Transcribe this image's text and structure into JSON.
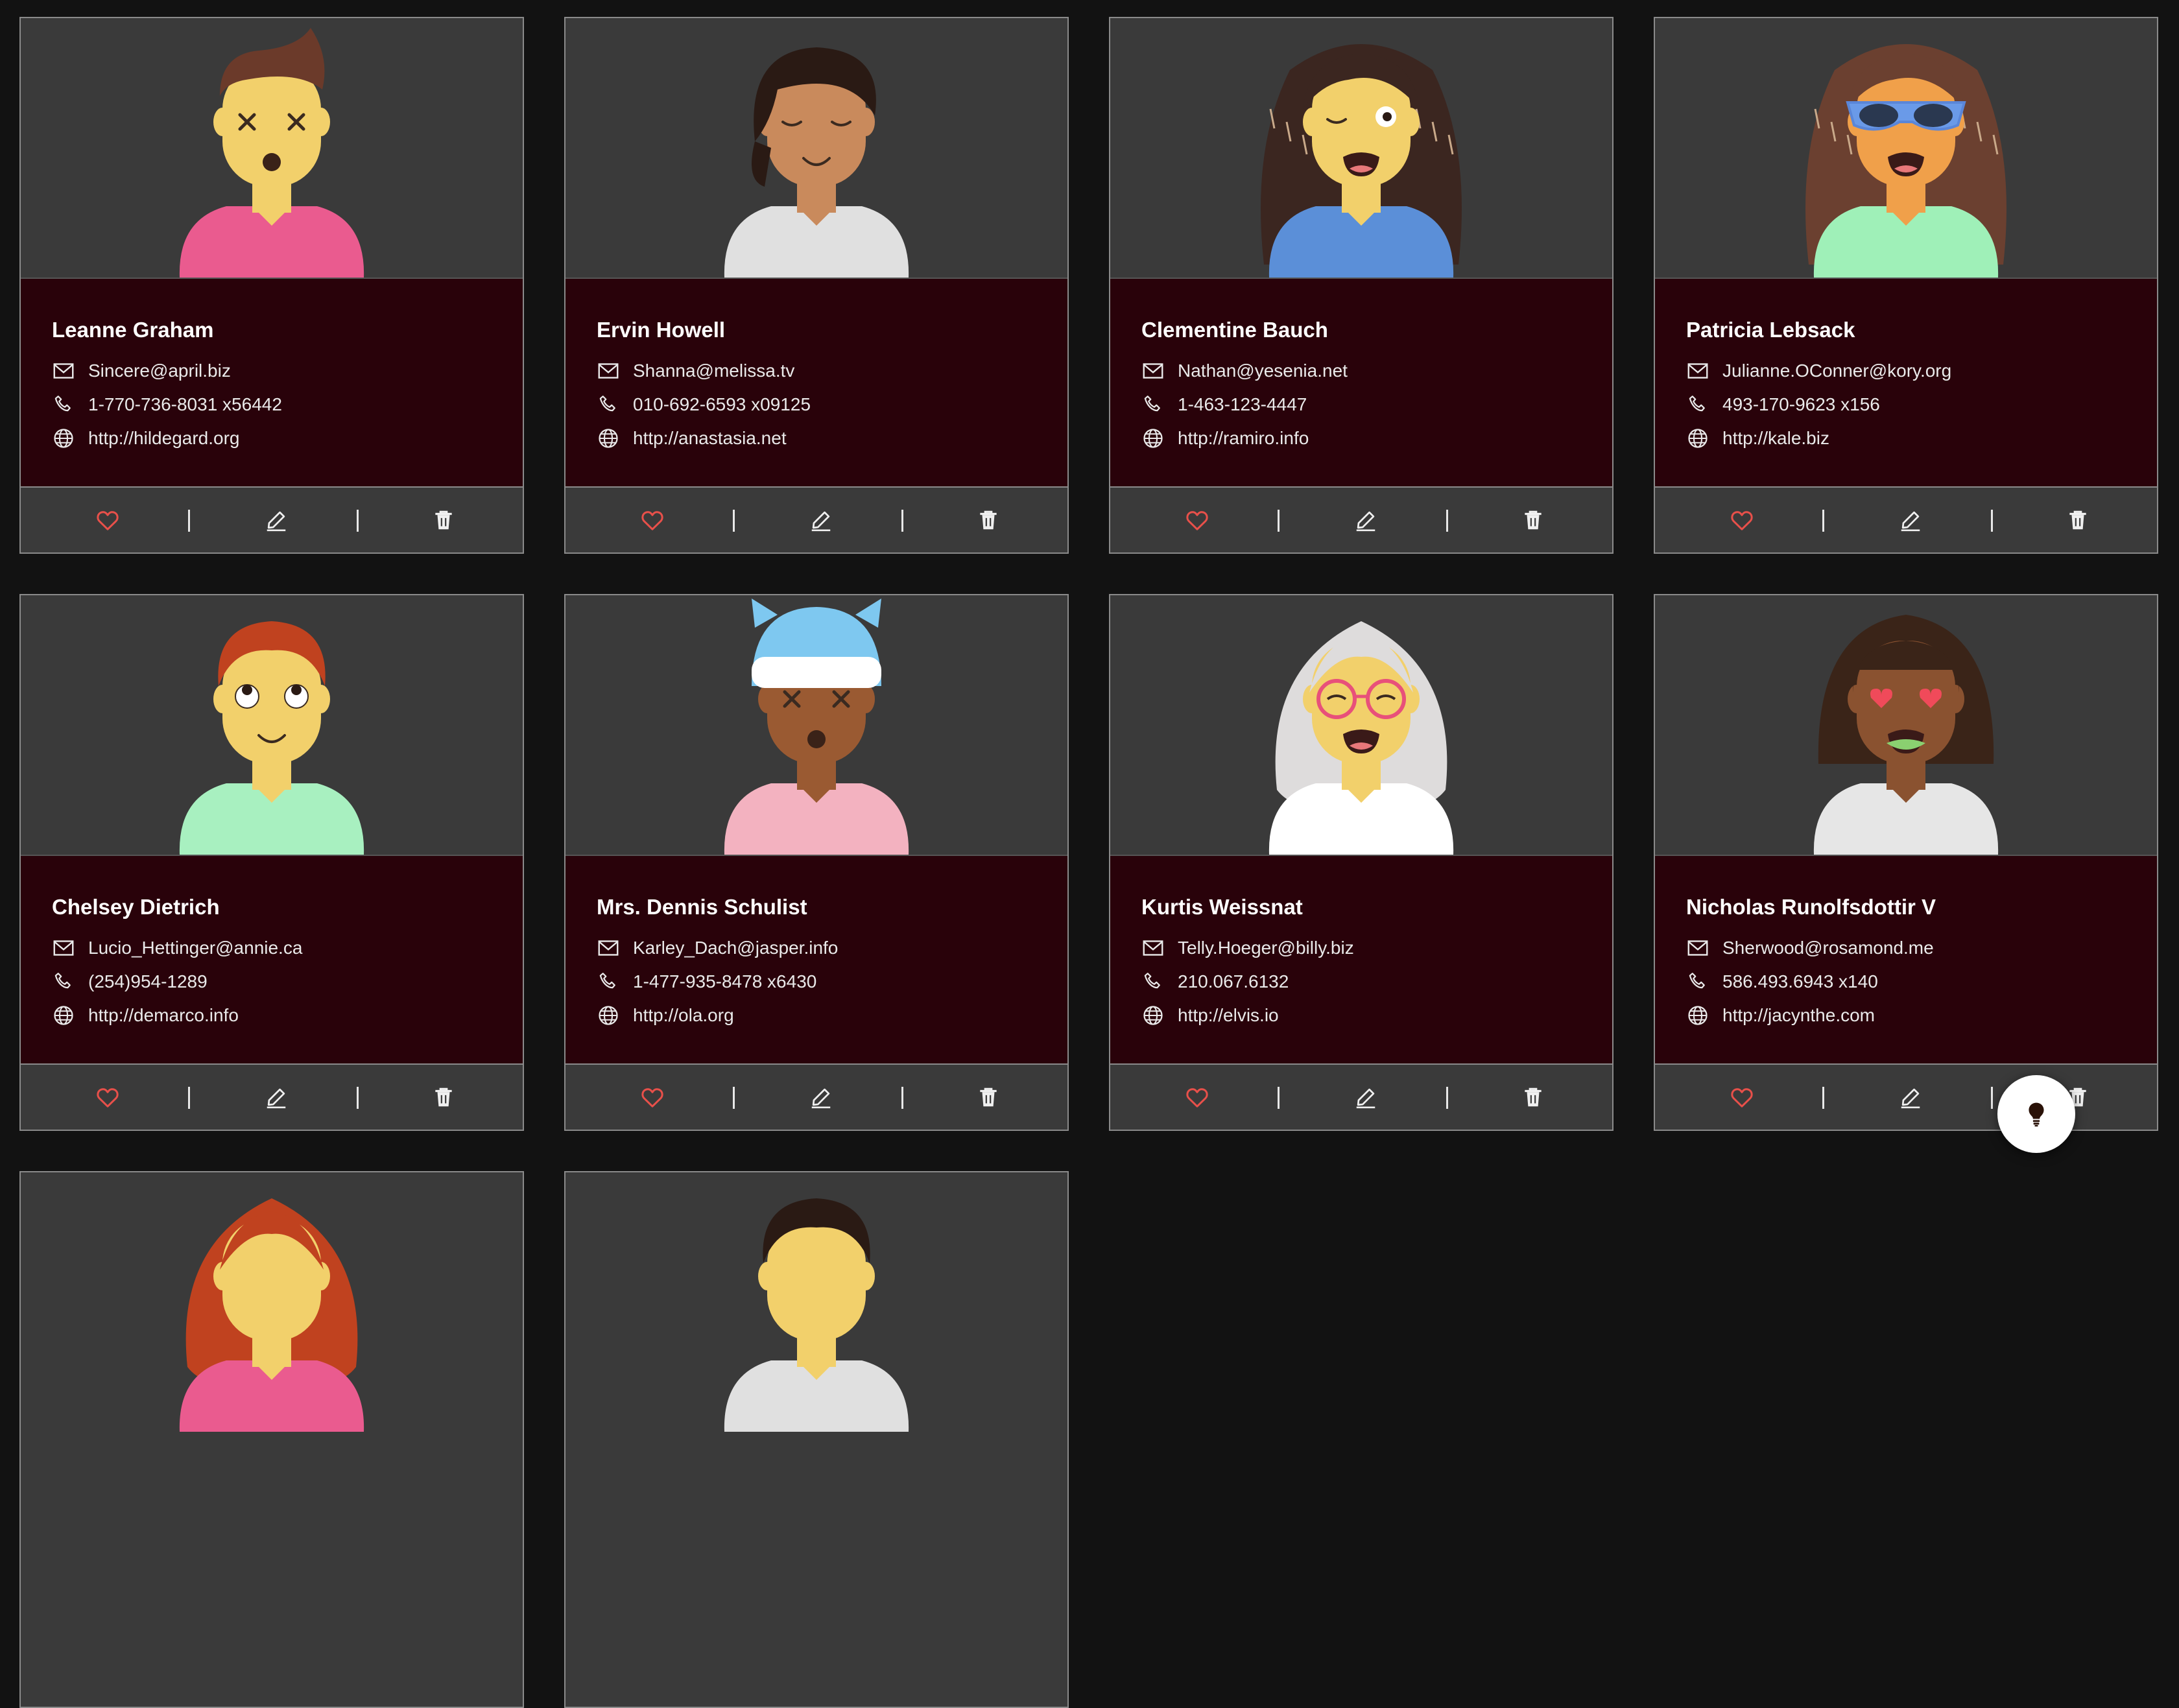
{
  "contacts": [
    {
      "name": "Leanne Graham",
      "email": "Sincere@april.biz",
      "phone": "1-770-736-8031 x56442",
      "website": "http://hildegard.org",
      "avatar": {
        "skin": "#f2d06b",
        "hair": "#6b3a2a",
        "shirt": "#ea5b8f",
        "hair_style": "quiff",
        "eyes": "x",
        "mouth": "open-small"
      }
    },
    {
      "name": "Ervin Howell",
      "email": "Shanna@melissa.tv",
      "phone": "010-692-6593 x09125",
      "website": "http://anastasia.net",
      "avatar": {
        "skin": "#c98a5c",
        "hair": "#2a1a14",
        "shirt": "#e0e0e0",
        "hair_style": "bob",
        "eyes": "closed",
        "mouth": "smile"
      }
    },
    {
      "name": "Clementine Bauch",
      "email": "Nathan@yesenia.net",
      "phone": "1-463-123-4447",
      "website": "http://ramiro.info",
      "avatar": {
        "skin": "#f2d06b",
        "hair": "#3b2620",
        "shirt": "#5b8fd8",
        "hair_style": "dreads",
        "eyes": "wink",
        "mouth": "open-wide"
      }
    },
    {
      "name": "Patricia Lebsack",
      "email": "Julianne.OConner@kory.org",
      "phone": "493-170-9623 x156",
      "website": "http://kale.biz",
      "avatar": {
        "skin": "#f0a04a",
        "hair": "#6b4030",
        "shirt": "#9ff0b8",
        "hair_style": "dreads",
        "eyes": "sunglasses",
        "mouth": "open-wide"
      }
    },
    {
      "name": "Chelsey Dietrich",
      "email": "Lucio_Hettinger@annie.ca",
      "phone": "(254)954-1289",
      "website": "http://demarco.info",
      "avatar": {
        "skin": "#f2d06b",
        "hair": "#c0421f",
        "shirt": "#a8f0c0",
        "hair_style": "short",
        "eyes": "roll",
        "mouth": "smile"
      }
    },
    {
      "name": "Mrs. Dennis Schulist",
      "email": "Karley_Dach@jasper.info",
      "phone": "1-477-935-8478 x6430",
      "website": "http://ola.org",
      "avatar": {
        "skin": "#9a5a32",
        "hair": "#7ec8f0",
        "shirt": "#f3b2c0",
        "hair_style": "beanie",
        "eyes": "x",
        "mouth": "open-small"
      }
    },
    {
      "name": "Kurtis Weissnat",
      "email": "Telly.Hoeger@billy.biz",
      "phone": "210.067.6132",
      "website": "http://elvis.io",
      "avatar": {
        "skin": "#f2d06b",
        "hair": "#dedcdc",
        "shirt": "#ffffff",
        "hair_style": "long",
        "eyes": "glasses",
        "mouth": "open-wide"
      }
    },
    {
      "name": "Nicholas Runolfsdottir V",
      "email": "Sherwood@rosamond.me",
      "phone": "586.493.6943 x140",
      "website": "http://jacynthe.com",
      "avatar": {
        "skin": "#8a5230",
        "hair": "#3a2418",
        "shirt": "#e6e6e6",
        "hair_style": "bob-long",
        "eyes": "hearts",
        "mouth": "open-green"
      }
    },
    {
      "name": "",
      "email": "",
      "phone": "",
      "website": "",
      "avatar": {
        "skin": "#f2d06b",
        "hair": "#c0421f",
        "shirt": "#ea5b8f",
        "hair_style": "long",
        "eyes": "none",
        "mouth": "none"
      }
    },
    {
      "name": "",
      "email": "",
      "phone": "",
      "website": "",
      "avatar": {
        "skin": "#f2d06b",
        "hair": "#2a1a14",
        "shirt": "#e0e0e0",
        "hair_style": "short",
        "eyes": "none",
        "mouth": "none"
      }
    }
  ],
  "icons": {
    "like": "heart-outline-icon",
    "edit": "pencil-icon",
    "delete": "trash-icon",
    "email": "mail-icon",
    "phone": "phone-icon",
    "website": "globe-icon",
    "fab": "lightbulb-icon"
  },
  "colors": {
    "page_bg": "#121212",
    "card_bg": "#3a3a3a",
    "info_bg": "#29020a",
    "heart": "#e8504a"
  }
}
